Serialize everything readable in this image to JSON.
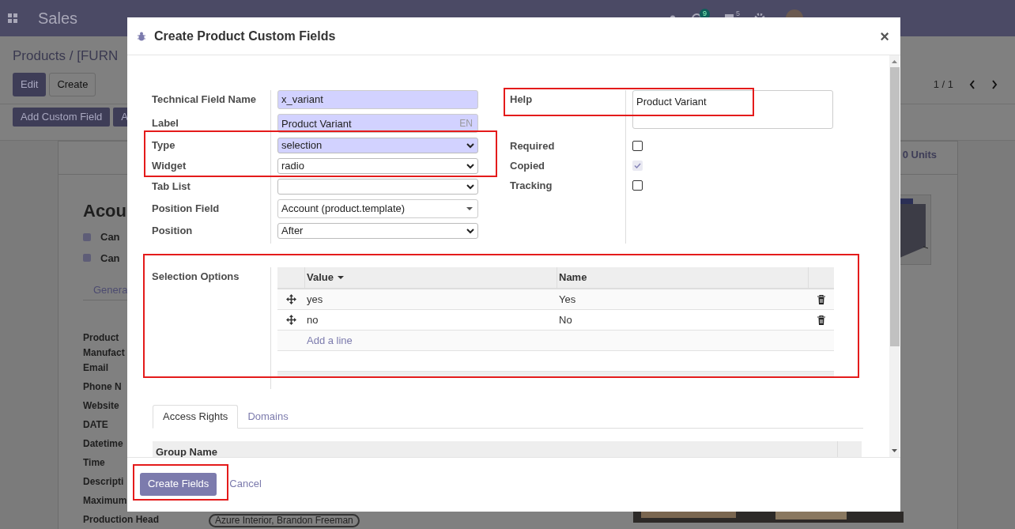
{
  "navbar": {
    "app": "Sales",
    "activity_count": "9",
    "message_count": "5"
  },
  "breadcrumb": "Products / [FURN",
  "buttons": [
    "Edit",
    "Create"
  ],
  "pager": "1 / 1",
  "toolbar": [
    "Add Custom Field",
    "A"
  ],
  "form": {
    "title": "Acou",
    "checkboxes": [
      {
        "label": "Can",
        "checked": true
      },
      {
        "label": "Can",
        "checked": true
      }
    ],
    "tab": "Genera",
    "labels": [
      "Product",
      "Manufact",
      "Email",
      "Phone N",
      "Website",
      "DATE",
      "Datetime",
      "Time",
      "Descripti",
      "Maximum",
      "Production Head"
    ],
    "tag": "Azure Interior, Brandon Freeman",
    "stat": "0 Units"
  },
  "dialog": {
    "title": "Create Product Custom Fields",
    "close": "×",
    "left_fields": [
      {
        "label": "Technical Field Name",
        "kind": "input",
        "value": "x_variant",
        "required": true
      },
      {
        "label": "Label",
        "kind": "translatable",
        "value": "Product Variant",
        "lang": "EN",
        "required": true
      },
      {
        "label": "Type",
        "kind": "select",
        "value": "selection",
        "required": true
      },
      {
        "label": "Widget",
        "kind": "select",
        "value": "radio",
        "required": false
      },
      {
        "label": "Tab List",
        "kind": "select",
        "required": false
      },
      {
        "label": "Position Field",
        "kind": "many2one",
        "value": "Account (product.template)",
        "required": false
      },
      {
        "label": "Position",
        "kind": "select",
        "value": "After",
        "required": false
      }
    ],
    "help": {
      "label": "Help",
      "value": "Product Variant"
    },
    "flags": [
      {
        "label": "Required",
        "checked": false,
        "disabled": false
      },
      {
        "label": "Copied",
        "checked": true,
        "disabled": true
      },
      {
        "label": "Tracking",
        "checked": false,
        "disabled": false
      }
    ],
    "selection": {
      "label": "Selection Options",
      "columns": [
        "Value",
        "Name"
      ],
      "rows": [
        {
          "value": "yes",
          "name": "Yes"
        },
        {
          "value": "no",
          "name": "No"
        }
      ],
      "add_line": "Add a line"
    },
    "tabs": [
      {
        "label": "Access Rights",
        "selected": true
      },
      {
        "label": "Domains",
        "selected": false
      }
    ],
    "group_header": "Group Name",
    "footer": {
      "primary": "Create Fields",
      "secondary": "Cancel"
    }
  }
}
